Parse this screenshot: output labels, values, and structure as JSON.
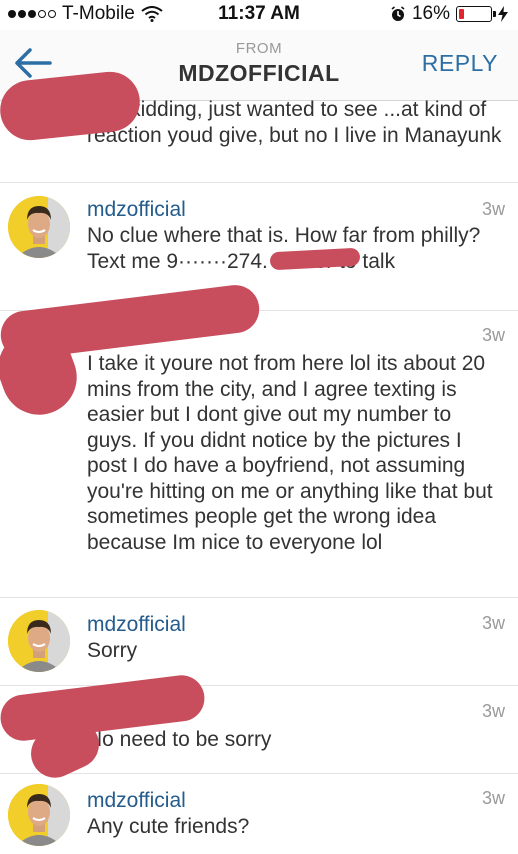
{
  "status_bar": {
    "carrier": "T-Mobile",
    "time": "11:37 AM",
    "battery": "16%",
    "battery_level": 0.16
  },
  "header": {
    "from_label": "FROM",
    "title": "MDZOFFICIAL",
    "reply_label": "REPLY"
  },
  "messages": [
    {
      "username": "",
      "timestamp": "",
      "text": "was kidding, just wanted to see ...at kind of reaction youd give, but no I live in Manayunk"
    },
    {
      "username": "mdzofficial",
      "timestamp": "3w",
      "text": "No clue where that is. How far from philly?  Text me 9·······274. Easier to talk"
    },
    {
      "username": "",
      "timestamp": "3w",
      "text": "I take it youre not from here lol its about 20 mins from the city, and I agree texting is easier but I dont give out my number to guys. If you didnt notice by the pictures I post I do have a boyfriend, not assuming you're hitting on me or anything like that but sometimes people get the wrong idea because Im nice to everyone lol"
    },
    {
      "username": "mdzofficial",
      "timestamp": "3w",
      "text": "Sorry"
    },
    {
      "username": "",
      "timestamp": "3w",
      "text": "No need to be sorry"
    },
    {
      "username": "mdzofficial",
      "timestamp": "3w",
      "text": "Any cute friends?"
    }
  ],
  "icons": {
    "back": "arrow-left-icon",
    "wifi": "wifi-icon",
    "alarm": "alarm-icon",
    "charging": "bolt-icon"
  },
  "colors": {
    "accent": "#2d6ea5",
    "username": "#245c8d",
    "censor": "#c84d5d",
    "battery_low": "#e0252f"
  }
}
